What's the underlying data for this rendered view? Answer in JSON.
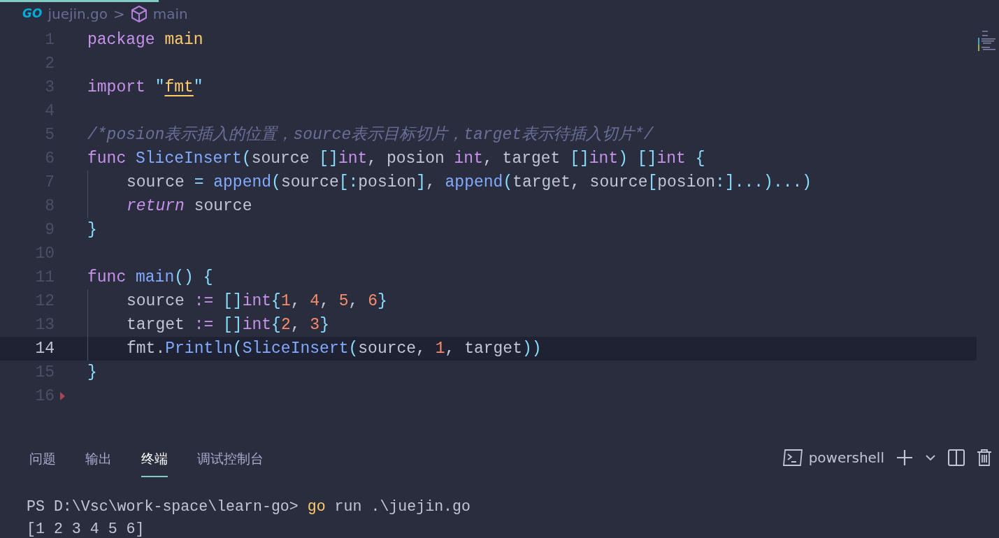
{
  "editor": {
    "breadcrumb": {
      "logo": "GO",
      "file": "juejin.go",
      "separator": ">",
      "symbol": "main"
    },
    "lines": [
      {
        "number": "1",
        "kind": "unchanged",
        "indented": false,
        "current": false,
        "tokens": [
          {
            "kind": "keyword",
            "text": "package "
          },
          {
            "kind": "name",
            "text": "main"
          }
        ]
      },
      {
        "number": "2",
        "kind": "unchanged",
        "indented": false,
        "current": false
      },
      {
        "number": "3",
        "kind": "unchanged",
        "indented": false,
        "current": false,
        "tokens": [
          {
            "kind": "keyword",
            "text": "import "
          },
          {
            "kind": "punct",
            "text": "\""
          },
          {
            "kind": "warn",
            "text": "fmt"
          },
          {
            "kind": "punct",
            "text": "\""
          }
        ]
      },
      {
        "number": "4",
        "kind": "unchanged",
        "indented": false,
        "current": false
      },
      {
        "number": "5",
        "kind": "modified",
        "indented": false,
        "current": false,
        "tokens": [
          {
            "kind": "comment",
            "text": "/*posion表示插入的位置，source表示目标切片，target表示待插入切片*/"
          }
        ]
      },
      {
        "number": "6",
        "kind": "modified",
        "indented": false,
        "current": false,
        "tokens": [
          {
            "kind": "keyword",
            "text": "func "
          },
          {
            "kind": "func",
            "text": "SliceInsert"
          },
          {
            "kind": "punct",
            "text": "("
          },
          {
            "kind": "plain",
            "text": "source "
          },
          {
            "kind": "punct",
            "text": "[]"
          },
          {
            "kind": "type",
            "text": "int"
          },
          {
            "kind": "plain",
            "text": ", posion "
          },
          {
            "kind": "type",
            "text": "int"
          },
          {
            "kind": "plain",
            "text": ", target "
          },
          {
            "kind": "punct",
            "text": "[]"
          },
          {
            "kind": "type",
            "text": "int"
          },
          {
            "kind": "punct",
            "text": ") []"
          },
          {
            "kind": "type",
            "text": "int"
          },
          {
            "kind": "punct",
            "text": " {"
          }
        ]
      },
      {
        "number": "7",
        "kind": "modified",
        "indented": true,
        "current": false,
        "tokens": [
          {
            "kind": "plain",
            "text": "source "
          },
          {
            "kind": "punct",
            "text": "= "
          },
          {
            "kind": "func",
            "text": "append"
          },
          {
            "kind": "punct",
            "text": "("
          },
          {
            "kind": "plain",
            "text": "source"
          },
          {
            "kind": "punct",
            "text": "[:"
          },
          {
            "kind": "plain",
            "text": "posion"
          },
          {
            "kind": "punct",
            "text": "]"
          },
          {
            "kind": "plain",
            "text": ", "
          },
          {
            "kind": "func",
            "text": "append"
          },
          {
            "kind": "punct",
            "text": "("
          },
          {
            "kind": "plain",
            "text": "target, source"
          },
          {
            "kind": "punct",
            "text": "["
          },
          {
            "kind": "plain",
            "text": "posion"
          },
          {
            "kind": "punct",
            "text": ":]...)...)"
          }
        ]
      },
      {
        "number": "8",
        "kind": "modified",
        "indented": true,
        "current": false,
        "tokens": [
          {
            "kind": "control",
            "text": "return"
          },
          {
            "kind": "plain",
            "text": " source"
          }
        ]
      },
      {
        "number": "9",
        "kind": "modified",
        "indented": false,
        "current": false,
        "tokens": [
          {
            "kind": "punct",
            "text": "}"
          }
        ]
      },
      {
        "number": "10",
        "kind": "added",
        "indented": false,
        "current": false
      },
      {
        "number": "11",
        "kind": "added",
        "indented": false,
        "current": false,
        "tokens": [
          {
            "kind": "keyword",
            "text": "func "
          },
          {
            "kind": "func",
            "text": "main"
          },
          {
            "kind": "punct",
            "text": "() {"
          }
        ]
      },
      {
        "number": "12",
        "kind": "added",
        "indented": true,
        "current": false,
        "tokens": [
          {
            "kind": "plain",
            "text": "source "
          },
          {
            "kind": "keyword",
            "text": ":= "
          },
          {
            "kind": "punct",
            "text": "[]"
          },
          {
            "kind": "type",
            "text": "int"
          },
          {
            "kind": "punct",
            "text": "{"
          },
          {
            "kind": "number",
            "text": "1"
          },
          {
            "kind": "plain",
            "text": ", "
          },
          {
            "kind": "number",
            "text": "4"
          },
          {
            "kind": "plain",
            "text": ", "
          },
          {
            "kind": "number",
            "text": "5"
          },
          {
            "kind": "plain",
            "text": ", "
          },
          {
            "kind": "number",
            "text": "6"
          },
          {
            "kind": "punct",
            "text": "}"
          }
        ]
      },
      {
        "number": "13",
        "kind": "added",
        "indented": true,
        "current": false,
        "tokens": [
          {
            "kind": "plain",
            "text": "target "
          },
          {
            "kind": "keyword",
            "text": ":= "
          },
          {
            "kind": "punct",
            "text": "[]"
          },
          {
            "kind": "type",
            "text": "int"
          },
          {
            "kind": "punct",
            "text": "{"
          },
          {
            "kind": "number",
            "text": "2"
          },
          {
            "kind": "plain",
            "text": ", "
          },
          {
            "kind": "number",
            "text": "3"
          },
          {
            "kind": "punct",
            "text": "}"
          }
        ]
      },
      {
        "number": "14",
        "kind": "added",
        "indented": true,
        "current": true,
        "tokens": [
          {
            "kind": "plain",
            "text": "fmt."
          },
          {
            "kind": "func",
            "text": "Println"
          },
          {
            "kind": "punct",
            "text": "("
          },
          {
            "kind": "func",
            "text": "SliceInsert"
          },
          {
            "kind": "punct",
            "text": "("
          },
          {
            "kind": "plain",
            "text": "source, "
          },
          {
            "kind": "number",
            "text": "1"
          },
          {
            "kind": "plain",
            "text": ", target"
          },
          {
            "kind": "punct",
            "text": "))"
          }
        ]
      },
      {
        "number": "15",
        "kind": "unchanged",
        "indented": false,
        "current": false,
        "tokens": [
          {
            "kind": "punct",
            "text": "}"
          }
        ]
      },
      {
        "number": "16",
        "kind": "deleted",
        "indented": false,
        "current": false
      }
    ]
  },
  "panel": {
    "tabs": [
      {
        "label": "问题",
        "selected": false
      },
      {
        "label": "输出",
        "selected": false
      },
      {
        "label": "终端",
        "selected": true
      },
      {
        "label": "调试控制台",
        "selected": false
      }
    ],
    "shell": "powershell",
    "terminal": [
      {
        "prompt": "PS D:\\Vsc\\work-space\\learn-go> ",
        "command": "go",
        "args": " run .\\juejin.go"
      },
      {
        "output": "[1 2 3 4 5 6]"
      }
    ]
  }
}
